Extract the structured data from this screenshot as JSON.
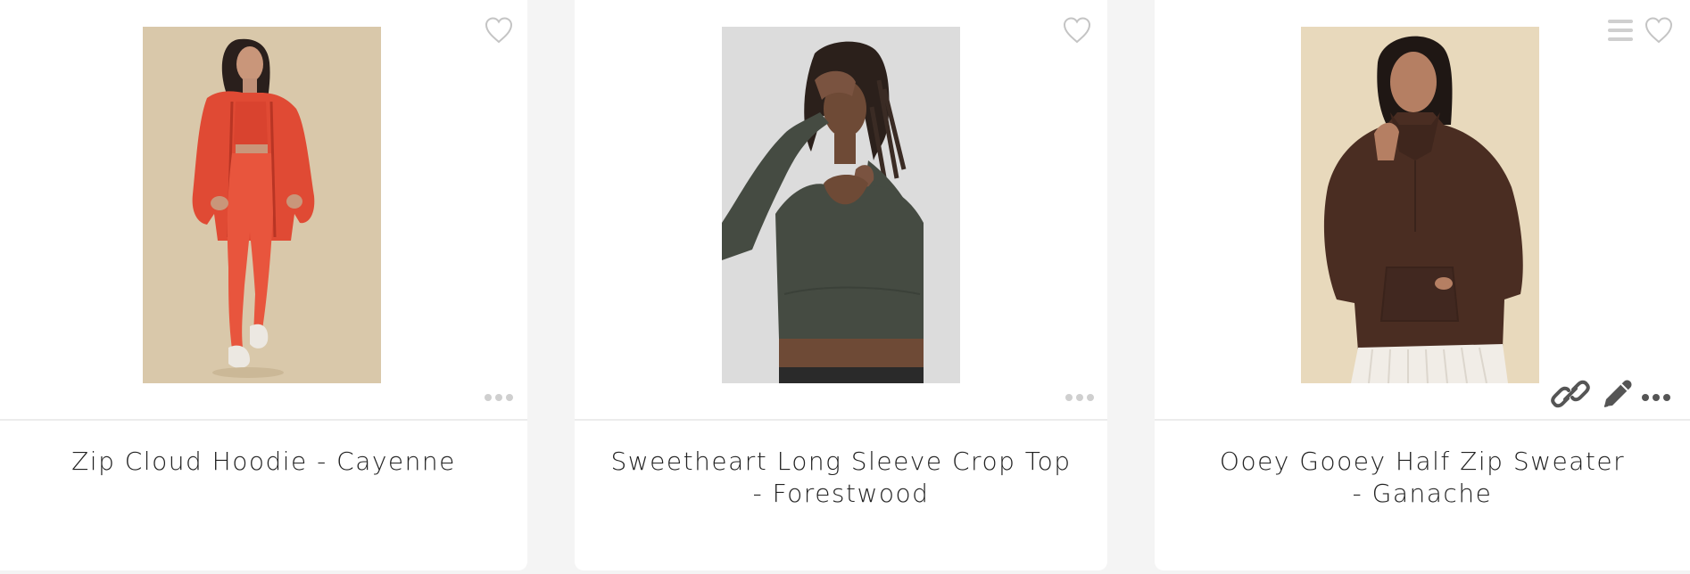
{
  "products": [
    {
      "title": "Zip Cloud Hoodie - Cayenne",
      "image_alt": "Model wearing red zip hoodie, bra top and leggings",
      "favorite": false,
      "colors": {
        "background": "#d9c8aa",
        "garment": "#e04a34",
        "skin": "#c9967a",
        "hair": "#2a1f1c",
        "shoes": "#ece8e2"
      }
    },
    {
      "title": "Sweetheart Long Sleeve Crop Top - Forestwood",
      "image_alt": "Model wearing dark green long sleeve crop top",
      "favorite": false,
      "colors": {
        "background": "#dcdcdc",
        "garment": "#454b42",
        "skin": "#6e4a36",
        "hair": "#2b201b"
      }
    },
    {
      "title": "Ooey Gooey Half Zip Sweater - Ganache",
      "image_alt": "Model wearing brown half zip sweater with white pleated skirt",
      "favorite": false,
      "colors": {
        "background": "#e8d9bc",
        "garment": "#4a2d22",
        "skin": "#b57f63",
        "hair": "#1f1714",
        "skirt": "#f1ede7"
      }
    }
  ],
  "icons": {
    "favorite": "heart-outline-icon",
    "more": "ellipsis-icon",
    "list": "hamburger-menu-icon",
    "link": "link-icon",
    "edit": "pencil-icon"
  }
}
